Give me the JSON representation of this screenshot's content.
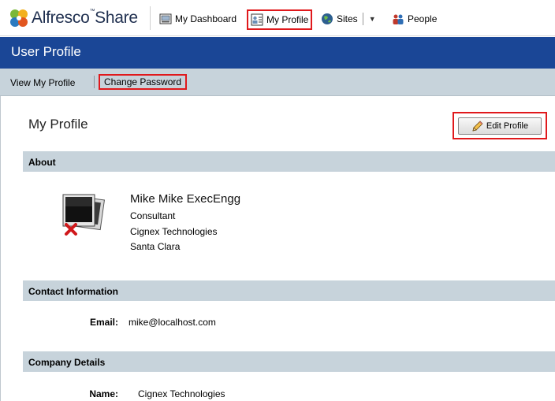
{
  "header": {
    "logo_text": "Alfresco",
    "logo_tm": "™",
    "logo_text2": "Share",
    "nav": [
      {
        "label": "My Dashboard",
        "icon": "dashboard-icon"
      },
      {
        "label": "My Profile",
        "icon": "profile-icon"
      },
      {
        "label": "Sites",
        "icon": "globe-icon"
      },
      {
        "label": "People",
        "icon": "people-icon"
      }
    ]
  },
  "titlebar": {
    "title": "User Profile"
  },
  "subnav": {
    "view_profile": "View My Profile",
    "change_password": "Change Password"
  },
  "main": {
    "title": "My Profile",
    "edit_button": "Edit Profile",
    "about": {
      "header": "About",
      "name": "Mike Mike ExecEngg",
      "job_title": "Consultant",
      "organization": "Cignex Technologies",
      "location": "Santa Clara"
    },
    "contact": {
      "header": "Contact Information",
      "email_label": "Email:",
      "email_value": "mike@localhost.com"
    },
    "company": {
      "header": "Company Details",
      "name_label": "Name:",
      "name_value": "Cignex Technologies"
    }
  },
  "colors": {
    "brand_blue": "#1a4696",
    "section_grey": "#c7d3db",
    "highlight_red": "#e0191c"
  }
}
